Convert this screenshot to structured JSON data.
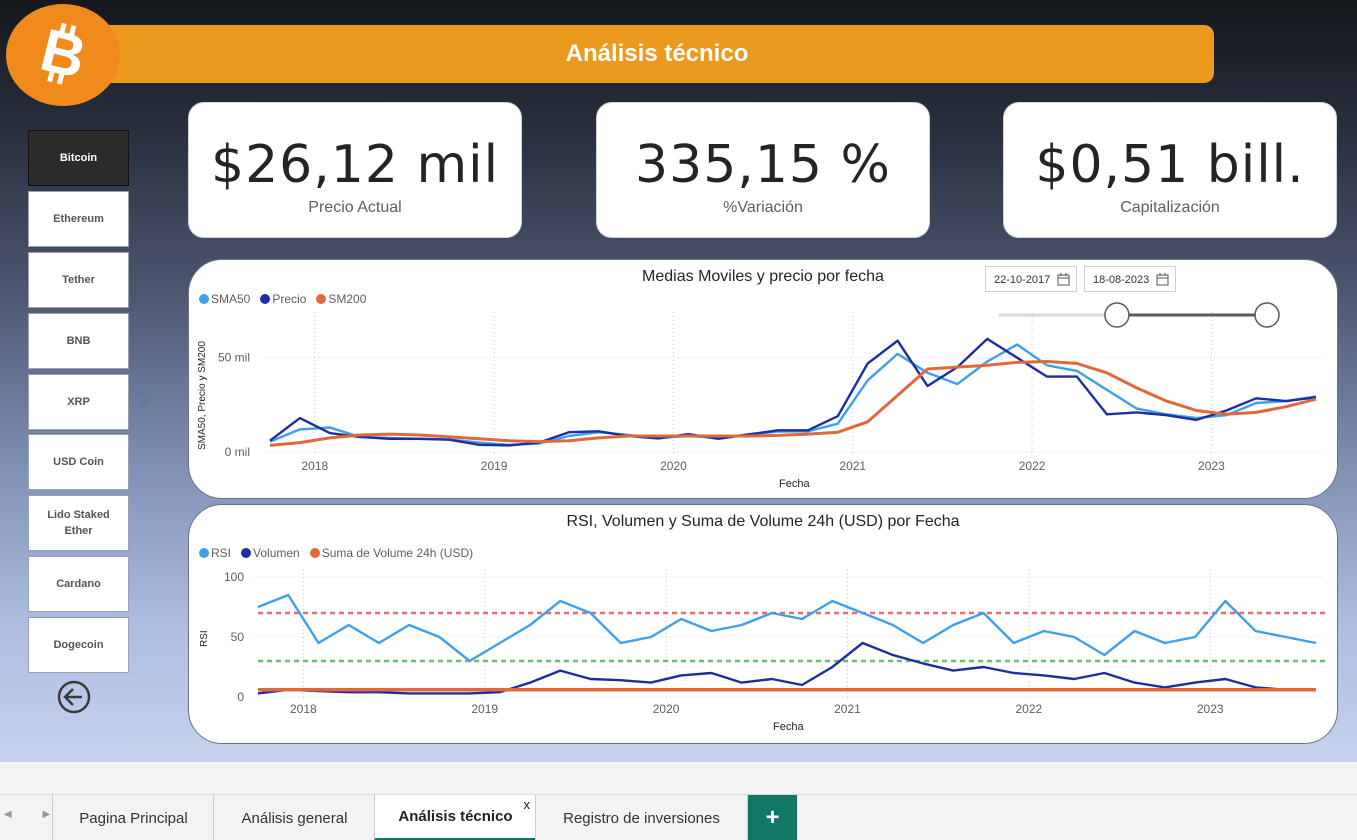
{
  "header": {
    "title": "Análisis técnico",
    "logo": "bitcoin-logo",
    "logo_color": "#f08a1c",
    "banner_color": "#ec9a1d"
  },
  "sidebar": {
    "items": [
      {
        "label": "Bitcoin",
        "active": true
      },
      {
        "label": "Ethereum",
        "active": false
      },
      {
        "label": "Tether",
        "active": false
      },
      {
        "label": "BNB",
        "active": false
      },
      {
        "label": "XRP",
        "active": false
      },
      {
        "label": "USD Coin",
        "active": false
      },
      {
        "label": "Lido Staked Ether",
        "active": false
      },
      {
        "label": "Cardano",
        "active": false
      },
      {
        "label": "Dogecoin",
        "active": false
      }
    ],
    "expand_icon": "chevron-right-icon",
    "back_icon": "back-arrow-icon"
  },
  "kpis": [
    {
      "value": "$26,12 mil",
      "label": "Precio Actual"
    },
    {
      "value": "335,15 %",
      "label": "%Variación"
    },
    {
      "value": "$0,51 bill.",
      "label": "Capitalización"
    }
  ],
  "date_filter": {
    "start": "22-10-2017",
    "end": "18-08-2023",
    "icon": "calendar-icon",
    "slider_start_fraction": 0.44,
    "slider_end_fraction": 1.0
  },
  "chart_data": [
    {
      "type": "line",
      "title": "Medias Moviles y precio por fecha",
      "xlabel": "Fecha",
      "ylabel": "SMA50, Precio y SM200",
      "x_ticks": [
        "2018",
        "2019",
        "2020",
        "2021",
        "2022",
        "2023"
      ],
      "y_ticks": [
        "0 mil",
        "50 mil"
      ],
      "ylim": [
        0,
        70000
      ],
      "grid": true,
      "legend_position": "top-left",
      "colors": {
        "SMA50": "#3ea0ea",
        "Precio": "#1c2ea0",
        "SM200": "#e0683a"
      },
      "x": [
        "2017-10",
        "2017-12",
        "2018-02",
        "2018-04",
        "2018-06",
        "2018-08",
        "2018-10",
        "2018-12",
        "2019-02",
        "2019-04",
        "2019-06",
        "2019-08",
        "2019-10",
        "2019-12",
        "2020-02",
        "2020-04",
        "2020-06",
        "2020-08",
        "2020-10",
        "2020-12",
        "2021-02",
        "2021-04",
        "2021-06",
        "2021-08",
        "2021-10",
        "2021-12",
        "2022-02",
        "2022-04",
        "2022-06",
        "2022-08",
        "2022-10",
        "2022-12",
        "2023-02",
        "2023-04",
        "2023-06",
        "2023-08"
      ],
      "series": [
        {
          "name": "SMA50",
          "values": [
            5500,
            12000,
            13000,
            8000,
            7500,
            7000,
            6600,
            5000,
            3800,
            4500,
            8500,
            10500,
            9000,
            7500,
            8500,
            7500,
            9300,
            10800,
            11000,
            15000,
            38000,
            52000,
            42000,
            36000,
            48000,
            57000,
            46000,
            43000,
            33000,
            23000,
            20000,
            18000,
            19500,
            26000,
            27000,
            29500
          ]
        },
        {
          "name": "Precio",
          "values": [
            6000,
            18000,
            10000,
            8000,
            7000,
            7000,
            6500,
            3800,
            3500,
            5000,
            10500,
            11000,
            8500,
            7200,
            9500,
            7000,
            9300,
            11500,
            11500,
            19000,
            47000,
            59000,
            35000,
            45000,
            60000,
            50000,
            40000,
            40000,
            20000,
            21000,
            19500,
            17000,
            22000,
            28500,
            27000,
            29000
          ]
        },
        {
          "name": "SM200",
          "values": [
            3500,
            5000,
            7500,
            9000,
            9500,
            9000,
            8000,
            7000,
            6000,
            5500,
            6000,
            7500,
            8500,
            8500,
            8500,
            8500,
            8500,
            8800,
            9500,
            10500,
            16000,
            30000,
            44000,
            45000,
            46000,
            47500,
            48000,
            47000,
            42000,
            34000,
            27000,
            22000,
            20000,
            21000,
            24000,
            28000
          ]
        }
      ]
    },
    {
      "type": "line",
      "title": "RSI, Volumen y Suma de Volume 24h (USD) por Fecha",
      "xlabel": "Fecha",
      "ylabel": "RSI",
      "x_ticks": [
        "2018",
        "2019",
        "2020",
        "2021",
        "2022",
        "2023"
      ],
      "y_ticks": [
        "0",
        "50",
        "100"
      ],
      "ylim": [
        0,
        100
      ],
      "grid": true,
      "legend_position": "top-left",
      "reference_lines": [
        {
          "value": 70,
          "color": "#e86a6a"
        },
        {
          "value": 30,
          "color": "#6bbf6b"
        }
      ],
      "colors": {
        "RSI": "#3ea0ea",
        "Volumen": "#1c2ea0",
        "Suma de Volume 24h (USD)": "#e0683a"
      },
      "x": [
        "2017-10",
        "2017-12",
        "2018-02",
        "2018-04",
        "2018-06",
        "2018-08",
        "2018-10",
        "2018-12",
        "2019-02",
        "2019-04",
        "2019-06",
        "2019-08",
        "2019-10",
        "2019-12",
        "2020-02",
        "2020-04",
        "2020-06",
        "2020-08",
        "2020-10",
        "2020-12",
        "2021-02",
        "2021-04",
        "2021-06",
        "2021-08",
        "2021-10",
        "2021-12",
        "2022-02",
        "2022-04",
        "2022-06",
        "2022-08",
        "2022-10",
        "2022-12",
        "2023-02",
        "2023-04",
        "2023-06",
        "2023-08"
      ],
      "series": [
        {
          "name": "RSI",
          "values": [
            75,
            85,
            45,
            60,
            45,
            60,
            50,
            30,
            45,
            60,
            80,
            70,
            45,
            50,
            65,
            55,
            60,
            70,
            65,
            80,
            70,
            60,
            45,
            60,
            70,
            45,
            55,
            50,
            35,
            55,
            45,
            50,
            80,
            55,
            50,
            45
          ]
        },
        {
          "name": "Volumen",
          "values": [
            3,
            6,
            5,
            4,
            4,
            3,
            3,
            3,
            4,
            12,
            22,
            15,
            14,
            12,
            18,
            20,
            12,
            15,
            10,
            25,
            45,
            35,
            28,
            22,
            25,
            20,
            18,
            15,
            20,
            12,
            8,
            12,
            15,
            8,
            6,
            6
          ]
        },
        {
          "name": "Suma de Volume 24h (USD)",
          "values": [
            6,
            6,
            6,
            6,
            6,
            6,
            6,
            6,
            6,
            6,
            6,
            6,
            6,
            6,
            6,
            6,
            6,
            6,
            6,
            6,
            6,
            6,
            6,
            6,
            6,
            6,
            6,
            6,
            6,
            6,
            6,
            6,
            6,
            6,
            6,
            6
          ]
        }
      ]
    }
  ],
  "tabs": {
    "items": [
      {
        "label": "Pagina Principal",
        "active": false
      },
      {
        "label": "Análisis general",
        "active": false
      },
      {
        "label": "Análisis técnico",
        "active": true
      },
      {
        "label": "Registro de inversiones",
        "active": false
      }
    ],
    "close_label": "x",
    "add_label": "+",
    "nav_arrows": "◀ ▶"
  }
}
